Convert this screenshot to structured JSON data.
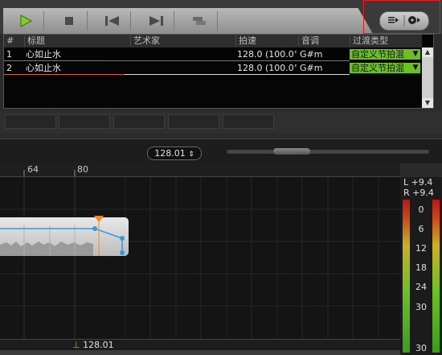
{
  "transport": {
    "buttons": [
      {
        "name": "play-button",
        "icon": "play-icon"
      },
      {
        "name": "stop-button",
        "icon": "stop-icon"
      },
      {
        "name": "previous-button",
        "icon": "skip-back-icon"
      },
      {
        "name": "next-button",
        "icon": "skip-forward-icon"
      },
      {
        "name": "extra-button",
        "icon": "layers-icon"
      }
    ],
    "play_color": "#7fd12a"
  },
  "playlist": {
    "columns": [
      "#",
      "标题",
      "艺术家",
      "拍速",
      "音调",
      "过渡类型"
    ],
    "rows": [
      {
        "num": "1",
        "title": "心如止水",
        "artist": "",
        "bpm": "128.0 (100.0°",
        "key": "G#m",
        "transition": "自定义节拍混"
      },
      {
        "num": "2",
        "title": "心如止水",
        "artist": "",
        "bpm": "128.0 (100.0°",
        "key": "G#m",
        "transition": "自定义节拍混"
      }
    ],
    "transition_color": "#6bbf25"
  },
  "editor": {
    "bpm_value": "128.01",
    "bpm_spinner": "⇕",
    "ruler_labels": [
      "64",
      "80"
    ],
    "bpm_marker": "128.01"
  },
  "meter": {
    "left_label": "L +9.4",
    "right_label": "R +9.4",
    "scale": [
      "0",
      "6",
      "12",
      "18",
      "24",
      "30",
      "30"
    ]
  }
}
